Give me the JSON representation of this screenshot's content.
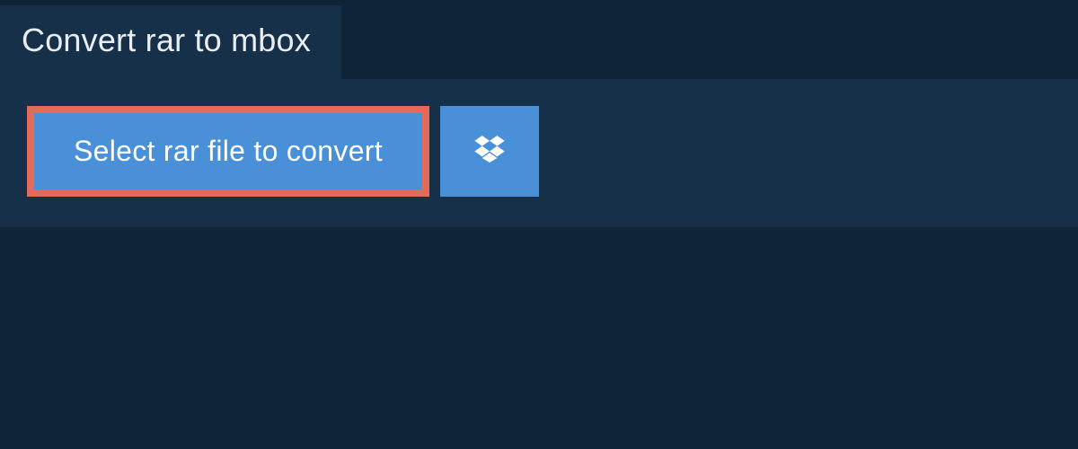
{
  "tab": {
    "label": "Convert rar to mbox"
  },
  "actions": {
    "select_label": "Select rar file to convert"
  }
}
